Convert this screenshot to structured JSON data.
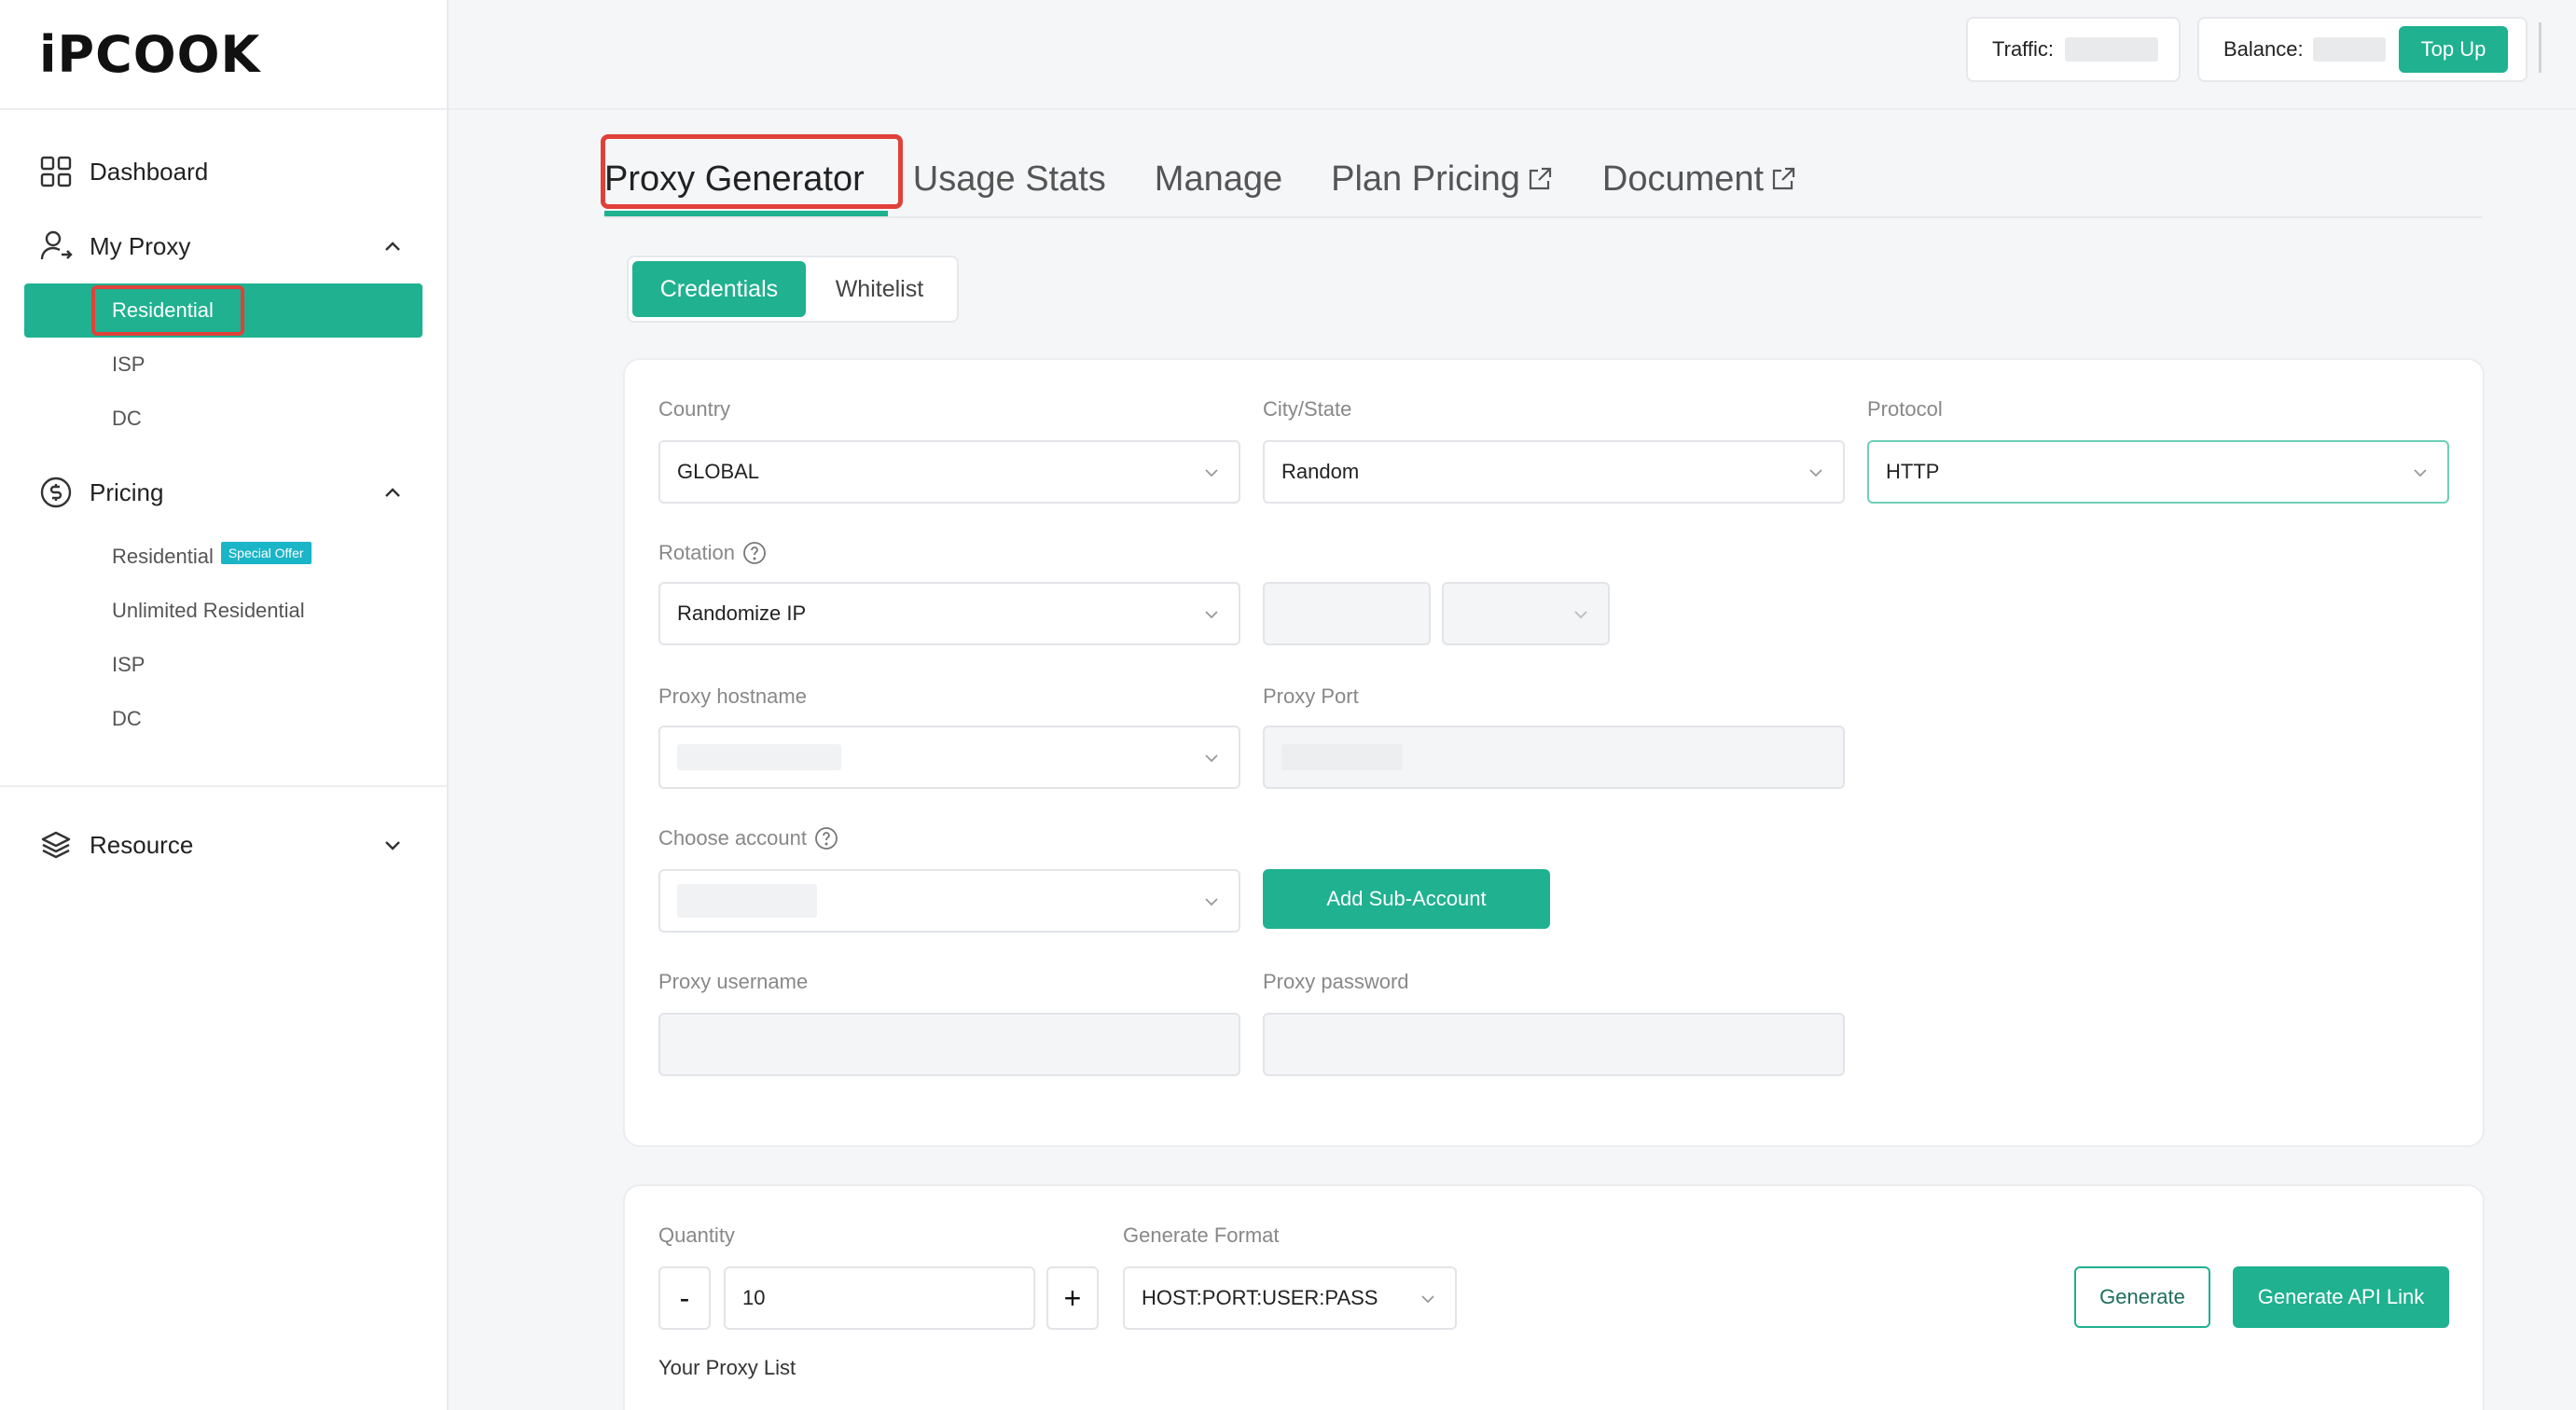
{
  "brand": {
    "logo": "iPCOOK"
  },
  "sidebar": {
    "dashboard": "Dashboard",
    "my_proxy": {
      "label": "My Proxy",
      "items": [
        "Residential",
        "ISP",
        "DC"
      ]
    },
    "pricing": {
      "label": "Pricing",
      "items": [
        "Residential",
        "Unlimited Residential",
        "ISP",
        "DC"
      ],
      "badge": "Special Offer"
    },
    "resource": "Resource"
  },
  "topbar": {
    "traffic_label": "Traffic:",
    "balance_label": "Balance:",
    "top_up": "Top Up"
  },
  "tabs": [
    {
      "label": "Proxy Generator",
      "active": true
    },
    {
      "label": "Usage Stats"
    },
    {
      "label": "Manage"
    },
    {
      "label": "Plan Pricing",
      "external": true
    },
    {
      "label": "Document",
      "external": true
    }
  ],
  "auth_mode": {
    "credentials": "Credentials",
    "whitelist": "Whitelist"
  },
  "form": {
    "country_label": "Country",
    "country_value": "GLOBAL",
    "city_label": "City/State",
    "city_value": "Random",
    "protocol_label": "Protocol",
    "protocol_value": "HTTP",
    "rotation_label": "Rotation",
    "rotation_value": "Randomize IP",
    "hostname_label": "Proxy hostname",
    "port_label": "Proxy Port",
    "account_label": "Choose account",
    "add_sub_account": "Add Sub-Account",
    "username_label": "Proxy username",
    "password_label": "Proxy password"
  },
  "generate": {
    "quantity_label": "Quantity",
    "quantity_value": "10",
    "minus": "-",
    "plus": "+",
    "format_label": "Generate Format",
    "format_value": "HOST:PORT:USER:PASS",
    "generate": "Generate",
    "generate_api": "Generate API Link",
    "list_label": "Your Proxy List"
  },
  "colors": {
    "accent": "#1fb190",
    "highlight": "#e0413a",
    "badge": "#1ab5c6"
  }
}
